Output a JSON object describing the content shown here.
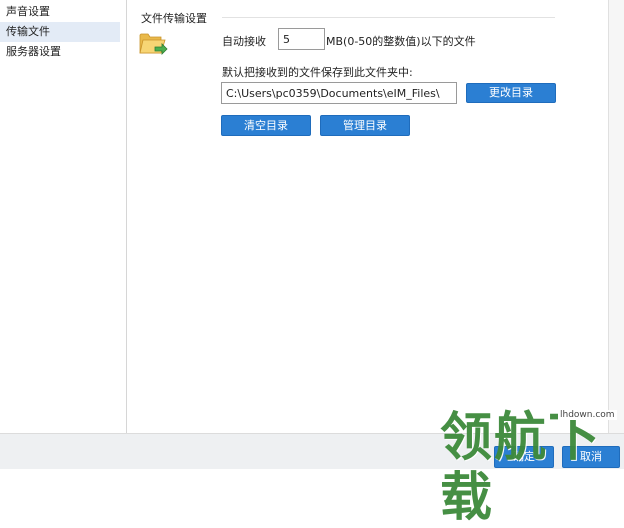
{
  "sidebar": {
    "items": [
      {
        "label": "声音设置"
      },
      {
        "label": "传输文件"
      },
      {
        "label": "服务器设置"
      }
    ]
  },
  "section": {
    "title": "文件传输设置"
  },
  "auto_receive": {
    "label": "自动接收",
    "value": "5",
    "suffix": "MB(0-50的整数值)以下的文件"
  },
  "save_folder": {
    "label": "默认把接收到的文件保存到此文件夹中:",
    "path": "C:\\Users\\pc0359\\Documents\\eIM_Files\\",
    "change_button": "更改目录",
    "clear_button": "清空目录",
    "manage_button": "管理目录"
  },
  "footer": {
    "ok_button": "确定",
    "cancel_button": "取消"
  },
  "watermark": {
    "text": "领航下载",
    "url": "lhdown.com"
  },
  "colors": {
    "accent": "#2b7fd3",
    "selected": "#e3ebf6"
  },
  "icons": {
    "folder": "folder-arrow-icon"
  }
}
